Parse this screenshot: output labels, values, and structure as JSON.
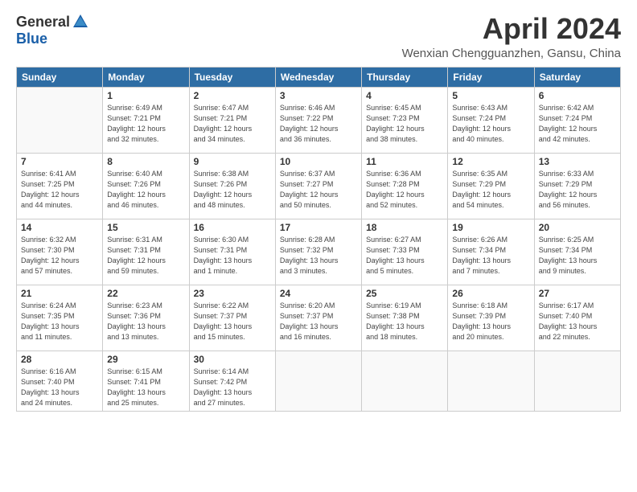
{
  "logo": {
    "general": "General",
    "blue": "Blue"
  },
  "title": "April 2024",
  "location": "Wenxian Chengguanzhen, Gansu, China",
  "days_header": [
    "Sunday",
    "Monday",
    "Tuesday",
    "Wednesday",
    "Thursday",
    "Friday",
    "Saturday"
  ],
  "weeks": [
    [
      {
        "day": "",
        "info": ""
      },
      {
        "day": "1",
        "info": "Sunrise: 6:49 AM\nSunset: 7:21 PM\nDaylight: 12 hours\nand 32 minutes."
      },
      {
        "day": "2",
        "info": "Sunrise: 6:47 AM\nSunset: 7:21 PM\nDaylight: 12 hours\nand 34 minutes."
      },
      {
        "day": "3",
        "info": "Sunrise: 6:46 AM\nSunset: 7:22 PM\nDaylight: 12 hours\nand 36 minutes."
      },
      {
        "day": "4",
        "info": "Sunrise: 6:45 AM\nSunset: 7:23 PM\nDaylight: 12 hours\nand 38 minutes."
      },
      {
        "day": "5",
        "info": "Sunrise: 6:43 AM\nSunset: 7:24 PM\nDaylight: 12 hours\nand 40 minutes."
      },
      {
        "day": "6",
        "info": "Sunrise: 6:42 AM\nSunset: 7:24 PM\nDaylight: 12 hours\nand 42 minutes."
      }
    ],
    [
      {
        "day": "7",
        "info": "Sunrise: 6:41 AM\nSunset: 7:25 PM\nDaylight: 12 hours\nand 44 minutes."
      },
      {
        "day": "8",
        "info": "Sunrise: 6:40 AM\nSunset: 7:26 PM\nDaylight: 12 hours\nand 46 minutes."
      },
      {
        "day": "9",
        "info": "Sunrise: 6:38 AM\nSunset: 7:26 PM\nDaylight: 12 hours\nand 48 minutes."
      },
      {
        "day": "10",
        "info": "Sunrise: 6:37 AM\nSunset: 7:27 PM\nDaylight: 12 hours\nand 50 minutes."
      },
      {
        "day": "11",
        "info": "Sunrise: 6:36 AM\nSunset: 7:28 PM\nDaylight: 12 hours\nand 52 minutes."
      },
      {
        "day": "12",
        "info": "Sunrise: 6:35 AM\nSunset: 7:29 PM\nDaylight: 12 hours\nand 54 minutes."
      },
      {
        "day": "13",
        "info": "Sunrise: 6:33 AM\nSunset: 7:29 PM\nDaylight: 12 hours\nand 56 minutes."
      }
    ],
    [
      {
        "day": "14",
        "info": "Sunrise: 6:32 AM\nSunset: 7:30 PM\nDaylight: 12 hours\nand 57 minutes."
      },
      {
        "day": "15",
        "info": "Sunrise: 6:31 AM\nSunset: 7:31 PM\nDaylight: 12 hours\nand 59 minutes."
      },
      {
        "day": "16",
        "info": "Sunrise: 6:30 AM\nSunset: 7:31 PM\nDaylight: 13 hours\nand 1 minute."
      },
      {
        "day": "17",
        "info": "Sunrise: 6:28 AM\nSunset: 7:32 PM\nDaylight: 13 hours\nand 3 minutes."
      },
      {
        "day": "18",
        "info": "Sunrise: 6:27 AM\nSunset: 7:33 PM\nDaylight: 13 hours\nand 5 minutes."
      },
      {
        "day": "19",
        "info": "Sunrise: 6:26 AM\nSunset: 7:34 PM\nDaylight: 13 hours\nand 7 minutes."
      },
      {
        "day": "20",
        "info": "Sunrise: 6:25 AM\nSunset: 7:34 PM\nDaylight: 13 hours\nand 9 minutes."
      }
    ],
    [
      {
        "day": "21",
        "info": "Sunrise: 6:24 AM\nSunset: 7:35 PM\nDaylight: 13 hours\nand 11 minutes."
      },
      {
        "day": "22",
        "info": "Sunrise: 6:23 AM\nSunset: 7:36 PM\nDaylight: 13 hours\nand 13 minutes."
      },
      {
        "day": "23",
        "info": "Sunrise: 6:22 AM\nSunset: 7:37 PM\nDaylight: 13 hours\nand 15 minutes."
      },
      {
        "day": "24",
        "info": "Sunrise: 6:20 AM\nSunset: 7:37 PM\nDaylight: 13 hours\nand 16 minutes."
      },
      {
        "day": "25",
        "info": "Sunrise: 6:19 AM\nSunset: 7:38 PM\nDaylight: 13 hours\nand 18 minutes."
      },
      {
        "day": "26",
        "info": "Sunrise: 6:18 AM\nSunset: 7:39 PM\nDaylight: 13 hours\nand 20 minutes."
      },
      {
        "day": "27",
        "info": "Sunrise: 6:17 AM\nSunset: 7:40 PM\nDaylight: 13 hours\nand 22 minutes."
      }
    ],
    [
      {
        "day": "28",
        "info": "Sunrise: 6:16 AM\nSunset: 7:40 PM\nDaylight: 13 hours\nand 24 minutes."
      },
      {
        "day": "29",
        "info": "Sunrise: 6:15 AM\nSunset: 7:41 PM\nDaylight: 13 hours\nand 25 minutes."
      },
      {
        "day": "30",
        "info": "Sunrise: 6:14 AM\nSunset: 7:42 PM\nDaylight: 13 hours\nand 27 minutes."
      },
      {
        "day": "",
        "info": ""
      },
      {
        "day": "",
        "info": ""
      },
      {
        "day": "",
        "info": ""
      },
      {
        "day": "",
        "info": ""
      }
    ]
  ]
}
